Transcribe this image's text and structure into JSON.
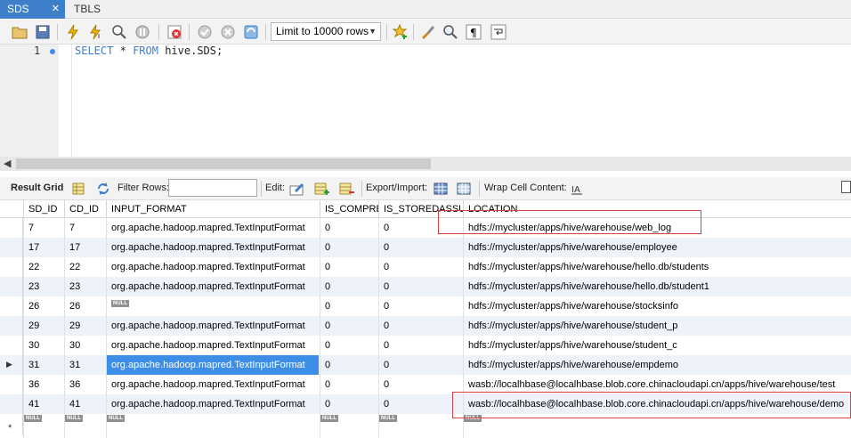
{
  "tabs": [
    {
      "label": "SDS",
      "close": "✕"
    },
    {
      "label": "TBLS"
    }
  ],
  "toolbar": {
    "limit_label": "Limit to 10000 rows"
  },
  "editor": {
    "line_number": "1",
    "kw1": "SELECT",
    "star": "*",
    "kw2": "FROM",
    "table": "hive.SDS;"
  },
  "result_toolbar": {
    "result_grid": "Result Grid",
    "filter_rows": "Filter Rows:",
    "filter_value": "",
    "edit": "Edit:",
    "export_import": "Export/Import:",
    "wrap_cell": "Wrap Cell Content:"
  },
  "grid": {
    "columns": [
      "SD_ID",
      "CD_ID",
      "INPUT_FORMAT",
      "IS_COMPRE",
      "IS_STOREDASSUB",
      "LOCATION"
    ],
    "null_label": "NULL",
    "new_row_marker": "*",
    "current_row_marker": "▶",
    "rows": [
      {
        "sd": "7",
        "cd": "7",
        "fmt": "org.apache.hadoop.mapred.TextInputFormat",
        "comp": "0",
        "sub": "0",
        "loc": "hdfs://mycluster/apps/hive/warehouse/web_log"
      },
      {
        "sd": "17",
        "cd": "17",
        "fmt": "org.apache.hadoop.mapred.TextInputFormat",
        "comp": "0",
        "sub": "0",
        "loc": "hdfs://mycluster/apps/hive/warehouse/employee"
      },
      {
        "sd": "22",
        "cd": "22",
        "fmt": "org.apache.hadoop.mapred.TextInputFormat",
        "comp": "0",
        "sub": "0",
        "loc": "hdfs://mycluster/apps/hive/warehouse/hello.db/students"
      },
      {
        "sd": "23",
        "cd": "23",
        "fmt": "org.apache.hadoop.mapred.TextInputFormat",
        "comp": "0",
        "sub": "0",
        "loc": "hdfs://mycluster/apps/hive/warehouse/hello.db/student1"
      },
      {
        "sd": "26",
        "cd": "26",
        "fmt": null,
        "comp": "0",
        "sub": "0",
        "loc": "hdfs://mycluster/apps/hive/warehouse/stocksinfo"
      },
      {
        "sd": "29",
        "cd": "29",
        "fmt": "org.apache.hadoop.mapred.TextInputFormat",
        "comp": "0",
        "sub": "0",
        "loc": "hdfs://mycluster/apps/hive/warehouse/student_p"
      },
      {
        "sd": "30",
        "cd": "30",
        "fmt": "org.apache.hadoop.mapred.TextInputFormat",
        "comp": "0",
        "sub": "0",
        "loc": "hdfs://mycluster/apps/hive/warehouse/student_c"
      },
      {
        "sd": "31",
        "cd": "31",
        "fmt": "org.apache.hadoop.mapred.TextInputFormat",
        "comp": "0",
        "sub": "0",
        "loc": "hdfs://mycluster/apps/hive/warehouse/empdemo"
      },
      {
        "sd": "36",
        "cd": "36",
        "fmt": "org.apache.hadoop.mapred.TextInputFormat",
        "comp": "0",
        "sub": "0",
        "loc": "wasb://localhbase@localhbase.blob.core.chinacloudapi.cn/apps/hive/warehouse/test"
      },
      {
        "sd": "41",
        "cd": "41",
        "fmt": "org.apache.hadoop.mapred.TextInputFormat",
        "comp": "0",
        "sub": "0",
        "loc": "wasb://localhbase@localhbase.blob.core.chinacloudapi.cn/apps/hive/warehouse/demo"
      }
    ]
  },
  "colors": {
    "accent": "#3d7fc9",
    "selection": "#3d8ee6",
    "highlight_box": "#d94040",
    "alt_row": "#eef3fb"
  }
}
